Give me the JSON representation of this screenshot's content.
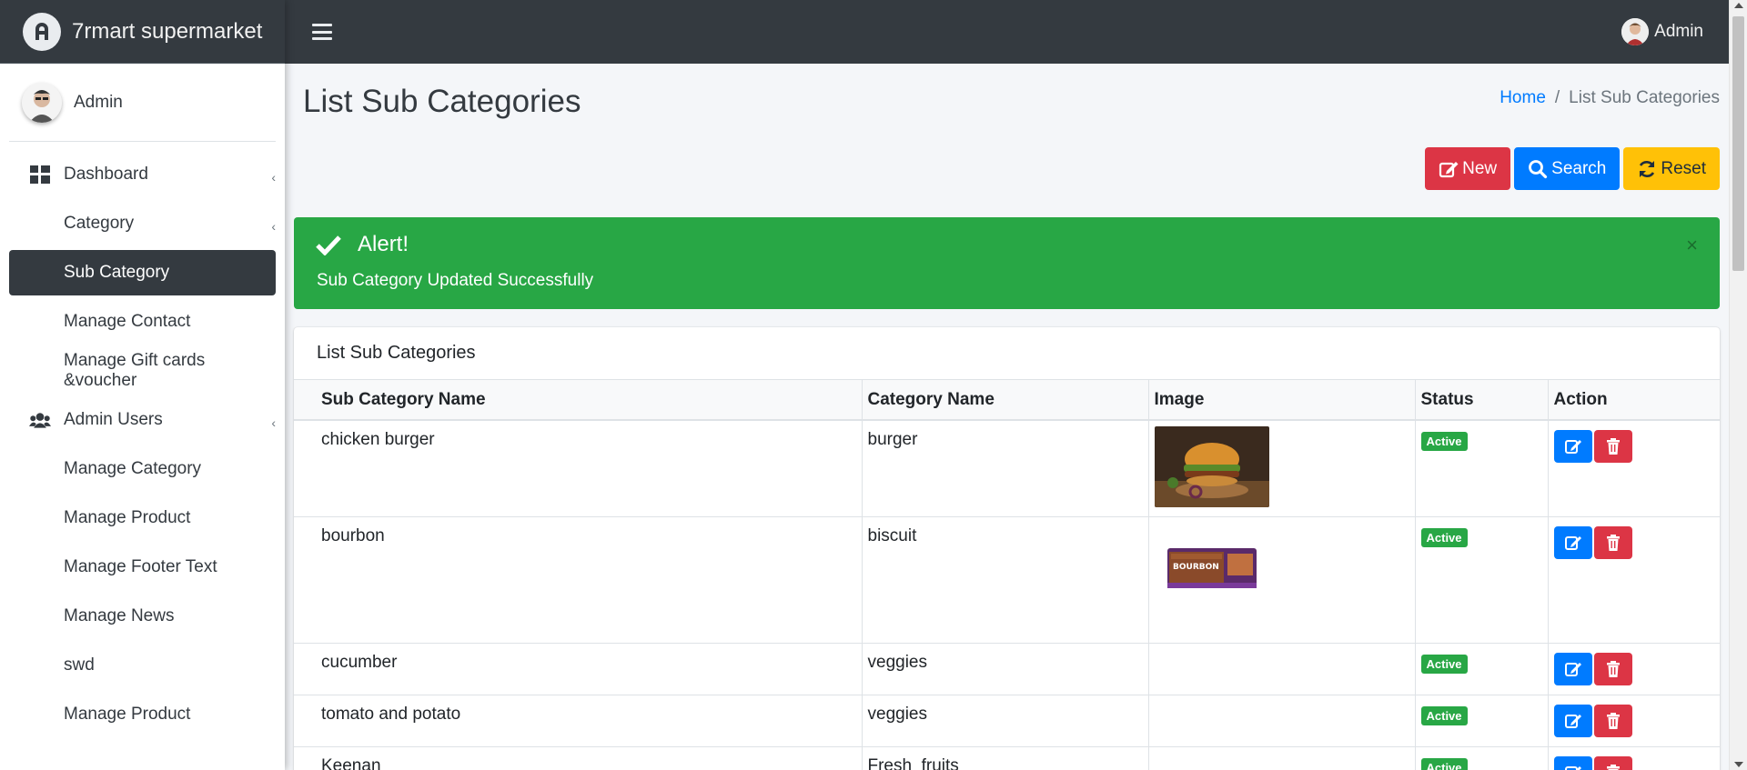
{
  "brand": {
    "name": "7rmart supermarket"
  },
  "sidebar": {
    "user": "Admin",
    "items": [
      {
        "label": "Dashboard",
        "icon": "grid-icon",
        "caret": true,
        "active": false
      },
      {
        "label": "Category",
        "caret": true,
        "active": false
      },
      {
        "label": "Sub Category",
        "active": true
      },
      {
        "label": "Manage Contact",
        "active": false
      },
      {
        "label": "Manage Gift cards &voucher",
        "active": false
      },
      {
        "label": "Admin Users",
        "icon": "users-icon",
        "caret": true,
        "active": false
      },
      {
        "label": "Manage Category",
        "active": false
      },
      {
        "label": "Manage Product",
        "active": false
      },
      {
        "label": "Manage Footer Text",
        "active": false
      },
      {
        "label": "Manage News",
        "active": false
      },
      {
        "label": "swd",
        "active": false
      },
      {
        "label": "Manage Product",
        "active": false
      }
    ]
  },
  "topbar": {
    "user": "Admin"
  },
  "page": {
    "title": "List Sub Categories",
    "breadcrumb": {
      "home": "Home",
      "current": "List Sub Categories"
    }
  },
  "buttons": {
    "new": "New",
    "search": "Search",
    "reset": "Reset"
  },
  "alert": {
    "title": "Alert!",
    "message": "Sub Category Updated Successfully",
    "close": "×",
    "color": "#28a745"
  },
  "table": {
    "card_title": "List Sub Categories",
    "columns": [
      "Sub Category Name",
      "Category Name",
      "Image",
      "Status",
      "Action"
    ],
    "rows": [
      {
        "sub_category": "chicken burger",
        "category": "burger",
        "image": "burger",
        "status": "Active"
      },
      {
        "sub_category": "bourbon",
        "category": "biscuit",
        "image": "biscuit",
        "status": "Active"
      },
      {
        "sub_category": "cucumber",
        "category": "veggies",
        "image": "",
        "status": "Active"
      },
      {
        "sub_category": "tomato and potato",
        "category": "veggies",
        "image": "",
        "status": "Active"
      },
      {
        "sub_category": "Keenan",
        "category": "Fresh_fruits",
        "image": "",
        "status": "Active"
      }
    ]
  },
  "colors": {
    "dark": "#343a40",
    "primary": "#007bff",
    "danger": "#dc3545",
    "warning": "#ffc107",
    "success": "#28a745"
  }
}
